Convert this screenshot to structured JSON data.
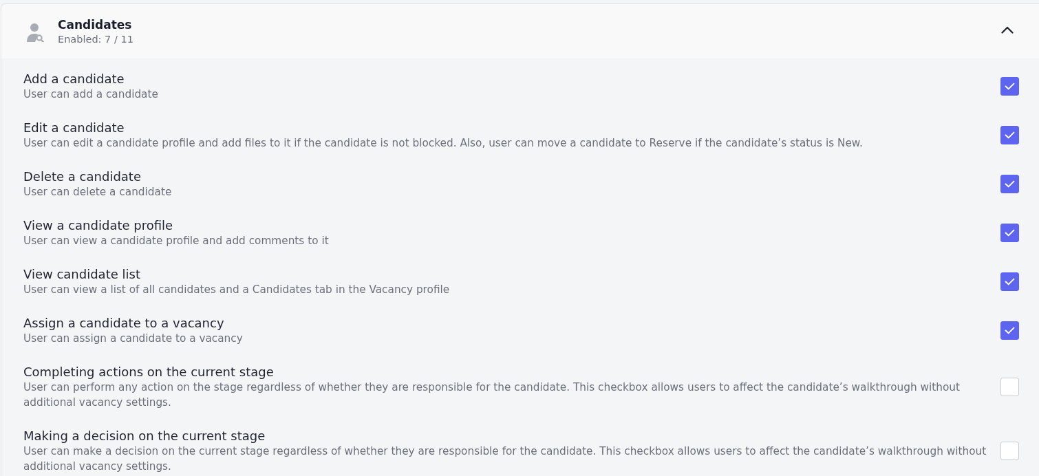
{
  "section": {
    "title": "Candidates",
    "subtitle": "Enabled: 7 / 11",
    "expanded": true
  },
  "permissions": [
    {
      "title": "Add a candidate",
      "description": "User can add a candidate",
      "checked": true
    },
    {
      "title": "Edit a candidate",
      "description": "User can edit a candidate profile and add files to it if the candidate is not blocked. Also, user can move a candidate to Reserve if the candidate’s status is New.",
      "checked": true
    },
    {
      "title": "Delete a candidate",
      "description": "User can delete a candidate",
      "checked": true
    },
    {
      "title": "View a candidate profile",
      "description": "User can view a candidate profile and add comments to it",
      "checked": true
    },
    {
      "title": "View candidate list",
      "description": "User can view a list of all candidates and a Candidates tab in the Vacancy profile",
      "checked": true
    },
    {
      "title": "Assign a candidate to a vacancy",
      "description": "User can assign a candidate to a vacancy",
      "checked": true
    },
    {
      "title": "Completing actions on the current stage",
      "description": "User can perform any action on the stage regardless of whether they are responsible for the candidate. This checkbox allows users to affect the candidate’s walkthrough without additional vacancy settings.",
      "checked": false
    },
    {
      "title": "Making a decision on the current stage",
      "description": "User can make a decision on the current stage regardless of whether they are responsible for the candidate. This checkbox allows users to affect the candidate’s walkthrough without additional vacancy settings.",
      "checked": false
    }
  ]
}
